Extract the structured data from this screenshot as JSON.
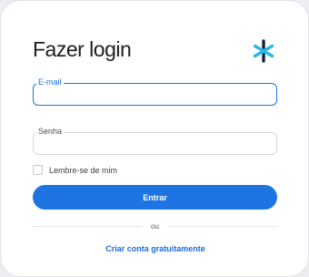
{
  "login": {
    "title": "Fazer login",
    "logo_icon": "asterisk-logo-icon",
    "email": {
      "label": "E-mail",
      "value": ""
    },
    "password": {
      "label": "Senha",
      "value": ""
    },
    "remember_label": "Lembre-se de mim",
    "remember_checked": false,
    "submit_label": "Entrar",
    "divider_text": "ou",
    "create_account_label": "Criar conta gratuitamente"
  },
  "colors": {
    "primary": "#1f74e4",
    "logo_dark": "#13233f",
    "logo_cyan": "#2bb6e8",
    "text": "#1b1d22"
  }
}
